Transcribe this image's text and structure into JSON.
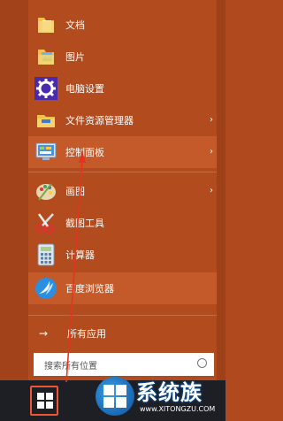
{
  "menu": {
    "items": [
      {
        "label": "文档",
        "icon": "folder-documents-icon"
      },
      {
        "label": "图片",
        "icon": "folder-pictures-icon"
      },
      {
        "label": "电脑设置",
        "icon": "gear-settings-icon"
      },
      {
        "label": "文件资源管理器",
        "icon": "file-explorer-icon"
      },
      {
        "label": "控制面板",
        "icon": "control-panel-icon"
      },
      {
        "label": "画图",
        "icon": "paint-palette-icon"
      },
      {
        "label": "截图工具",
        "icon": "snipping-scissors-icon"
      },
      {
        "label": "计算器",
        "icon": "calculator-icon"
      },
      {
        "label": "百度浏览器",
        "icon": "baidu-browser-icon"
      }
    ],
    "submenu_arrow": "›",
    "all_apps_arrow": "→",
    "all_apps_label": "所有应用"
  },
  "search": {
    "placeholder": "搜索所有位置"
  },
  "watermark": {
    "title": "系统族",
    "url": "www.XITONGZU.COM"
  },
  "colors": {
    "menu_bg": "#b24b1d",
    "highlight": "#c45a2a",
    "annotation": "#e53322",
    "taskbar": "#1e1f24"
  }
}
